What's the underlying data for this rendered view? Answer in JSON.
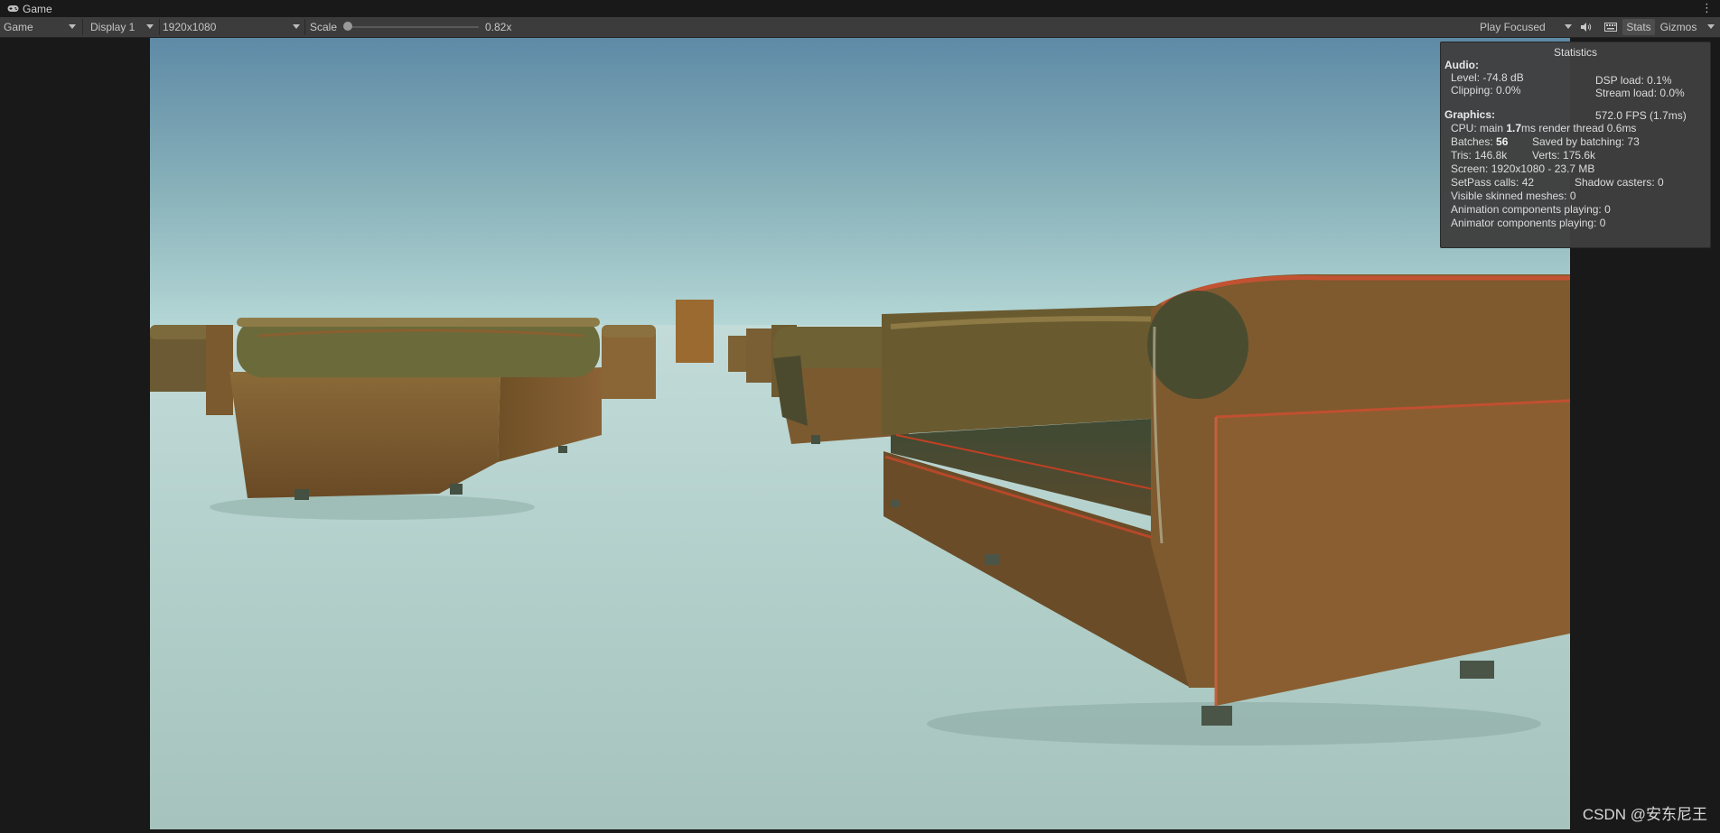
{
  "window": {
    "tab_title": "Game",
    "tab_icon": "gamepad-icon",
    "menu_icon": "kebab-menu-icon"
  },
  "toolbar": {
    "view_mode": "Game",
    "display": "Display 1",
    "resolution": "1920x1080",
    "scale_label": "Scale",
    "scale_value": "0.82x",
    "scale_min": 0.82,
    "play_mode": "Play Focused",
    "mute_icon": "speaker-icon",
    "keyboard_icon": "keyboard-icon",
    "stats_label": "Stats",
    "stats_active": true,
    "gizmos_label": "Gizmos"
  },
  "stats": {
    "title": "Statistics",
    "audio_header": "Audio:",
    "level": "Level: -74.8 dB",
    "clipping": "Clipping: 0.0%",
    "dsp_load": "DSP load: 0.1%",
    "stream_load": "Stream load: 0.0%",
    "fps": "572.0 FPS (1.7ms)",
    "graphics_header": "Graphics:",
    "cpu_prefix": "CPU: main ",
    "cpu_main": "1.7",
    "cpu_suffix": "ms  render thread 0.6ms",
    "batches_prefix": "Batches: ",
    "batches_value": "56",
    "saved_by_batching": "Saved by batching: 73",
    "tris": "Tris: 146.8k",
    "verts": "Verts: 175.6k",
    "screen": "Screen: 1920x1080 - 23.7 MB",
    "setpass": "SetPass calls: 42",
    "shadow_casters": "Shadow casters: 0",
    "skinned_meshes": "Visible skinned meshes: 0",
    "animation_components": "Animation components playing: 0",
    "animator_components": "Animator components playing: 0"
  },
  "watermark": "CSDN @安东尼王",
  "colors": {
    "sky_top": "#5e8aa6",
    "sky_horizon": "#b5d7d6",
    "floor": "#aac7c2",
    "sofa_body": "#7a5a2e",
    "sofa_edge": "#b04020"
  }
}
